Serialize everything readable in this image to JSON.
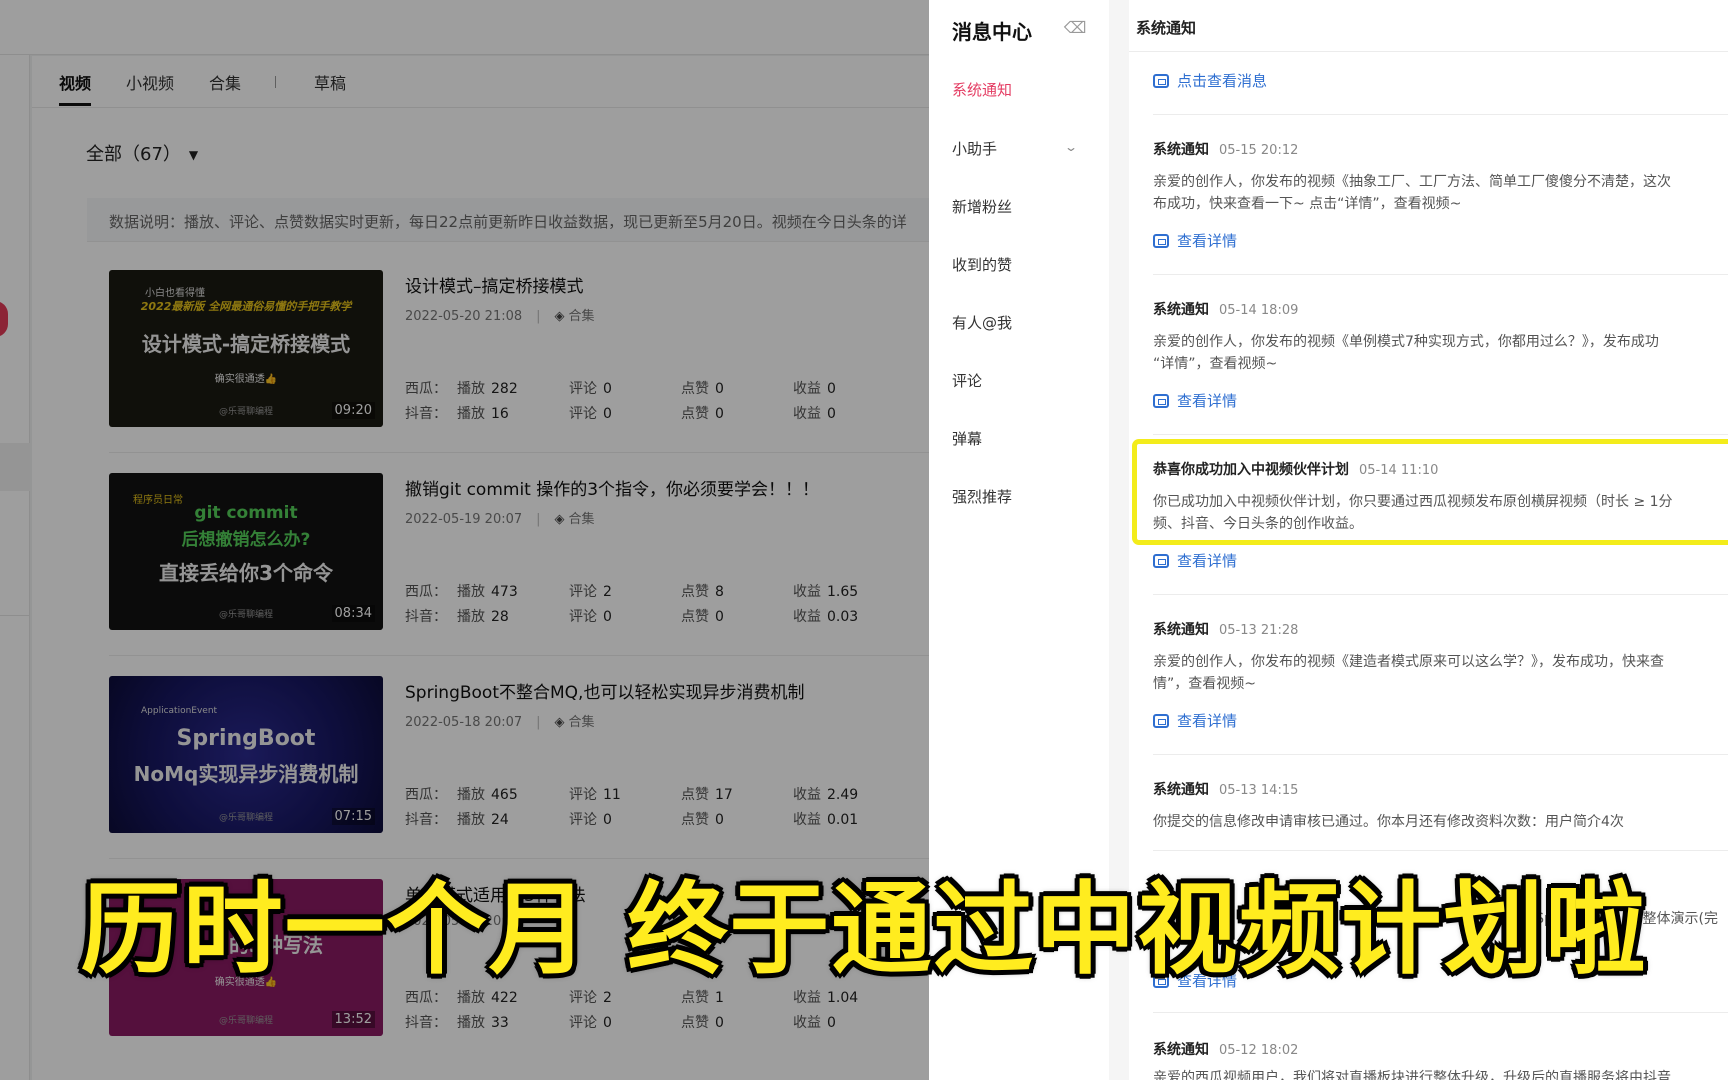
{
  "left": {
    "tabs": [
      "视频",
      "小视频",
      "合集",
      "草稿"
    ],
    "filter_label": "全部（67）",
    "notice": "数据说明：播放、评论、点赞数据实时更新，每日22点前更新昨日收益数据，现已更新至5月20日。视频在今日头条的详",
    "stat_labels": {
      "platform_a": "西瓜：",
      "platform_b": "抖音：",
      "plays": "播放",
      "comments": "评论",
      "likes": "点赞",
      "earnings": "收益"
    },
    "collection_label": "合集",
    "videos": [
      {
        "title": "设计模式–搞定桥接模式",
        "date": "2022-05-20 21:08",
        "duration": "09:20",
        "thumb_small": "小白也看得懂",
        "thumb_line1": "2022最新版 全网最通俗易懂的手把手教学",
        "thumb_main": "设计模式-搞定桥接模式",
        "thumb_tag": "确实很通透👍",
        "thumb_credit": "@乐哥聊编程",
        "xigua": {
          "plays": "282",
          "comments": "0",
          "likes": "0",
          "earnings": "0"
        },
        "douyin": {
          "plays": "16",
          "comments": "0",
          "likes": "0",
          "earnings": "0"
        }
      },
      {
        "title": "撤销git commit 操作的3个指令，你必须要学会！！！",
        "date": "2022-05-19 20:07",
        "duration": "08:34",
        "thumb_small": "程序员日常",
        "thumb_line1": "git commit",
        "thumb_line2": "后想撤销怎么办?",
        "thumb_main": "直接丢给你3个命令",
        "thumb_credit": "@乐哥聊编程",
        "xigua": {
          "plays": "473",
          "comments": "2",
          "likes": "8",
          "earnings": "1.65"
        },
        "douyin": {
          "plays": "28",
          "comments": "0",
          "likes": "0",
          "earnings": "0.03"
        }
      },
      {
        "title": "SpringBoot不整合MQ,也可以轻松实现异步消费机制",
        "date": "2022-05-18 20:07",
        "duration": "07:15",
        "thumb_small": "ApplicationEvent",
        "thumb_line1": "SpringBoot",
        "thumb_main": "NoMq实现异步消费机制",
        "thumb_credit": "@乐哥聊编程",
        "xigua": {
          "plays": "465",
          "comments": "11",
          "likes": "17",
          "earnings": "2.49"
        },
        "douyin": {
          "plays": "24",
          "comments": "0",
          "likes": "0",
          "earnings": "0.01"
        }
      },
      {
        "title": "单例模式适用的3种写法",
        "date": "2022-05-17 20:07",
        "duration": "13:52",
        "thumb_main": "的3种写法",
        "thumb_tag": "确实很通透👍",
        "thumb_credit": "@乐哥聊编程",
        "xigua": {
          "plays": "422",
          "comments": "2",
          "likes": "1",
          "earnings": "1.04"
        },
        "douyin": {
          "plays": "33",
          "comments": "0",
          "likes": "0",
          "earnings": "0"
        }
      }
    ]
  },
  "message_center": {
    "title": "消息中心",
    "nav_items": [
      "系统通知",
      "小助手",
      "新增粉丝",
      "收到的赞",
      "有人@我",
      "评论",
      "弹幕",
      "强烈推荐"
    ],
    "feed_title": "系统通知",
    "top_link": "点击查看消息",
    "detail_link": "查看详情",
    "messages": [
      {
        "who": "系统通知",
        "time": "05-15 20:12",
        "lines": [
          "亲爱的创作人，你发布的视频《抽象工厂、工厂方法、简单工厂傻傻分不清楚，这次",
          "布成功，快来查看一下~ 点击“详情”，查看视频~"
        ]
      },
      {
        "who": "系统通知",
        "time": "05-14 18:09",
        "lines": [
          "亲爱的创作人，你发布的视频《单例模式7种实现方式，你都用过么？》，发布成功",
          "“详情”，查看视频~"
        ]
      },
      {
        "who": "恭喜你成功加入中视频伙伴计划",
        "time": "05-14 11:10",
        "lines": [
          "你已成功加入中视频伙伴计划，你只要通过西瓜视频发布原创横屏视频（时长 ≥ 1分",
          "频、抖音、今日头条的创作收益。"
        ]
      },
      {
        "who": "系统通知",
        "time": "05-13 21:28",
        "lines": [
          "亲爱的创作人，你发布的视频《建造者模式原来可以这么学？》，发布成功，快来查",
          "情”，查看视频~"
        ]
      },
      {
        "who": "系统通知",
        "time": "05-13 14:15",
        "lines": [
          "你提交的信息修改申请审核已通过。你本月还有修改资料次数：用户简介4次"
        ]
      },
      {
        "who": "系统通知",
        "time": "05-12 18:02",
        "lines": [
          "亲爱的西瓜视频用户，我们将对直播板块进行整体升级，升级后的直播服务将由抖音"
        ]
      }
    ],
    "partial_line": "SpringCloud ... 整体演示(完"
  },
  "subtitle": "历时一个月 终于通过中视频计划啦"
}
